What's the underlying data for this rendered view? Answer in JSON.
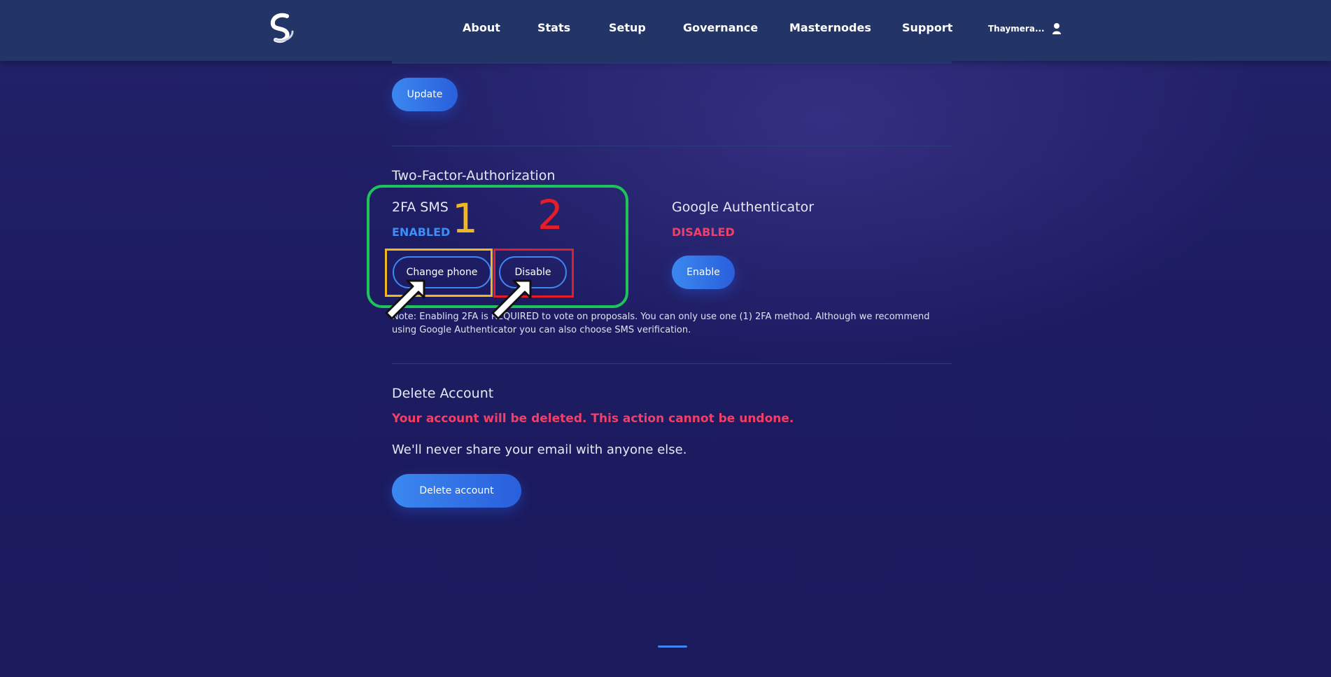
{
  "nav": {
    "items": [
      {
        "label": "About"
      },
      {
        "label": "Stats"
      },
      {
        "label": "Setup"
      },
      {
        "label": "Governance"
      },
      {
        "label": "Masternodes"
      },
      {
        "label": "Support"
      }
    ],
    "user_name": "Thaymera..."
  },
  "update_button": "Update",
  "two_factor": {
    "title": "Two-Factor-Authorization",
    "sms": {
      "label": "2FA SMS",
      "status": "ENABLED",
      "change_phone_button": "Change phone",
      "disable_button": "Disable"
    },
    "google": {
      "label": "Google Authenticator",
      "status": "DISABLED",
      "enable_button": "Enable"
    },
    "note": "Note: Enabling 2FA is REQUIRED to vote on proposals. You can only use one (1) 2FA method. Although we recommend using Google Authenticator you can also choose SMS verification."
  },
  "delete_account": {
    "title": "Delete Account",
    "warning": "Your account will be deleted. This action cannot be undone.",
    "privacy": "We'll never share your email with anyone else.",
    "button": "Delete account"
  },
  "annotations": {
    "one": "1",
    "two": "2"
  },
  "colors": {
    "enabled": "#3e8ef5",
    "disabled": "#f0406a",
    "warning": "#f0406a",
    "annotation_green": "#1ec35a",
    "annotation_yellow": "#f0b81e",
    "annotation_red": "#e31e2a"
  }
}
